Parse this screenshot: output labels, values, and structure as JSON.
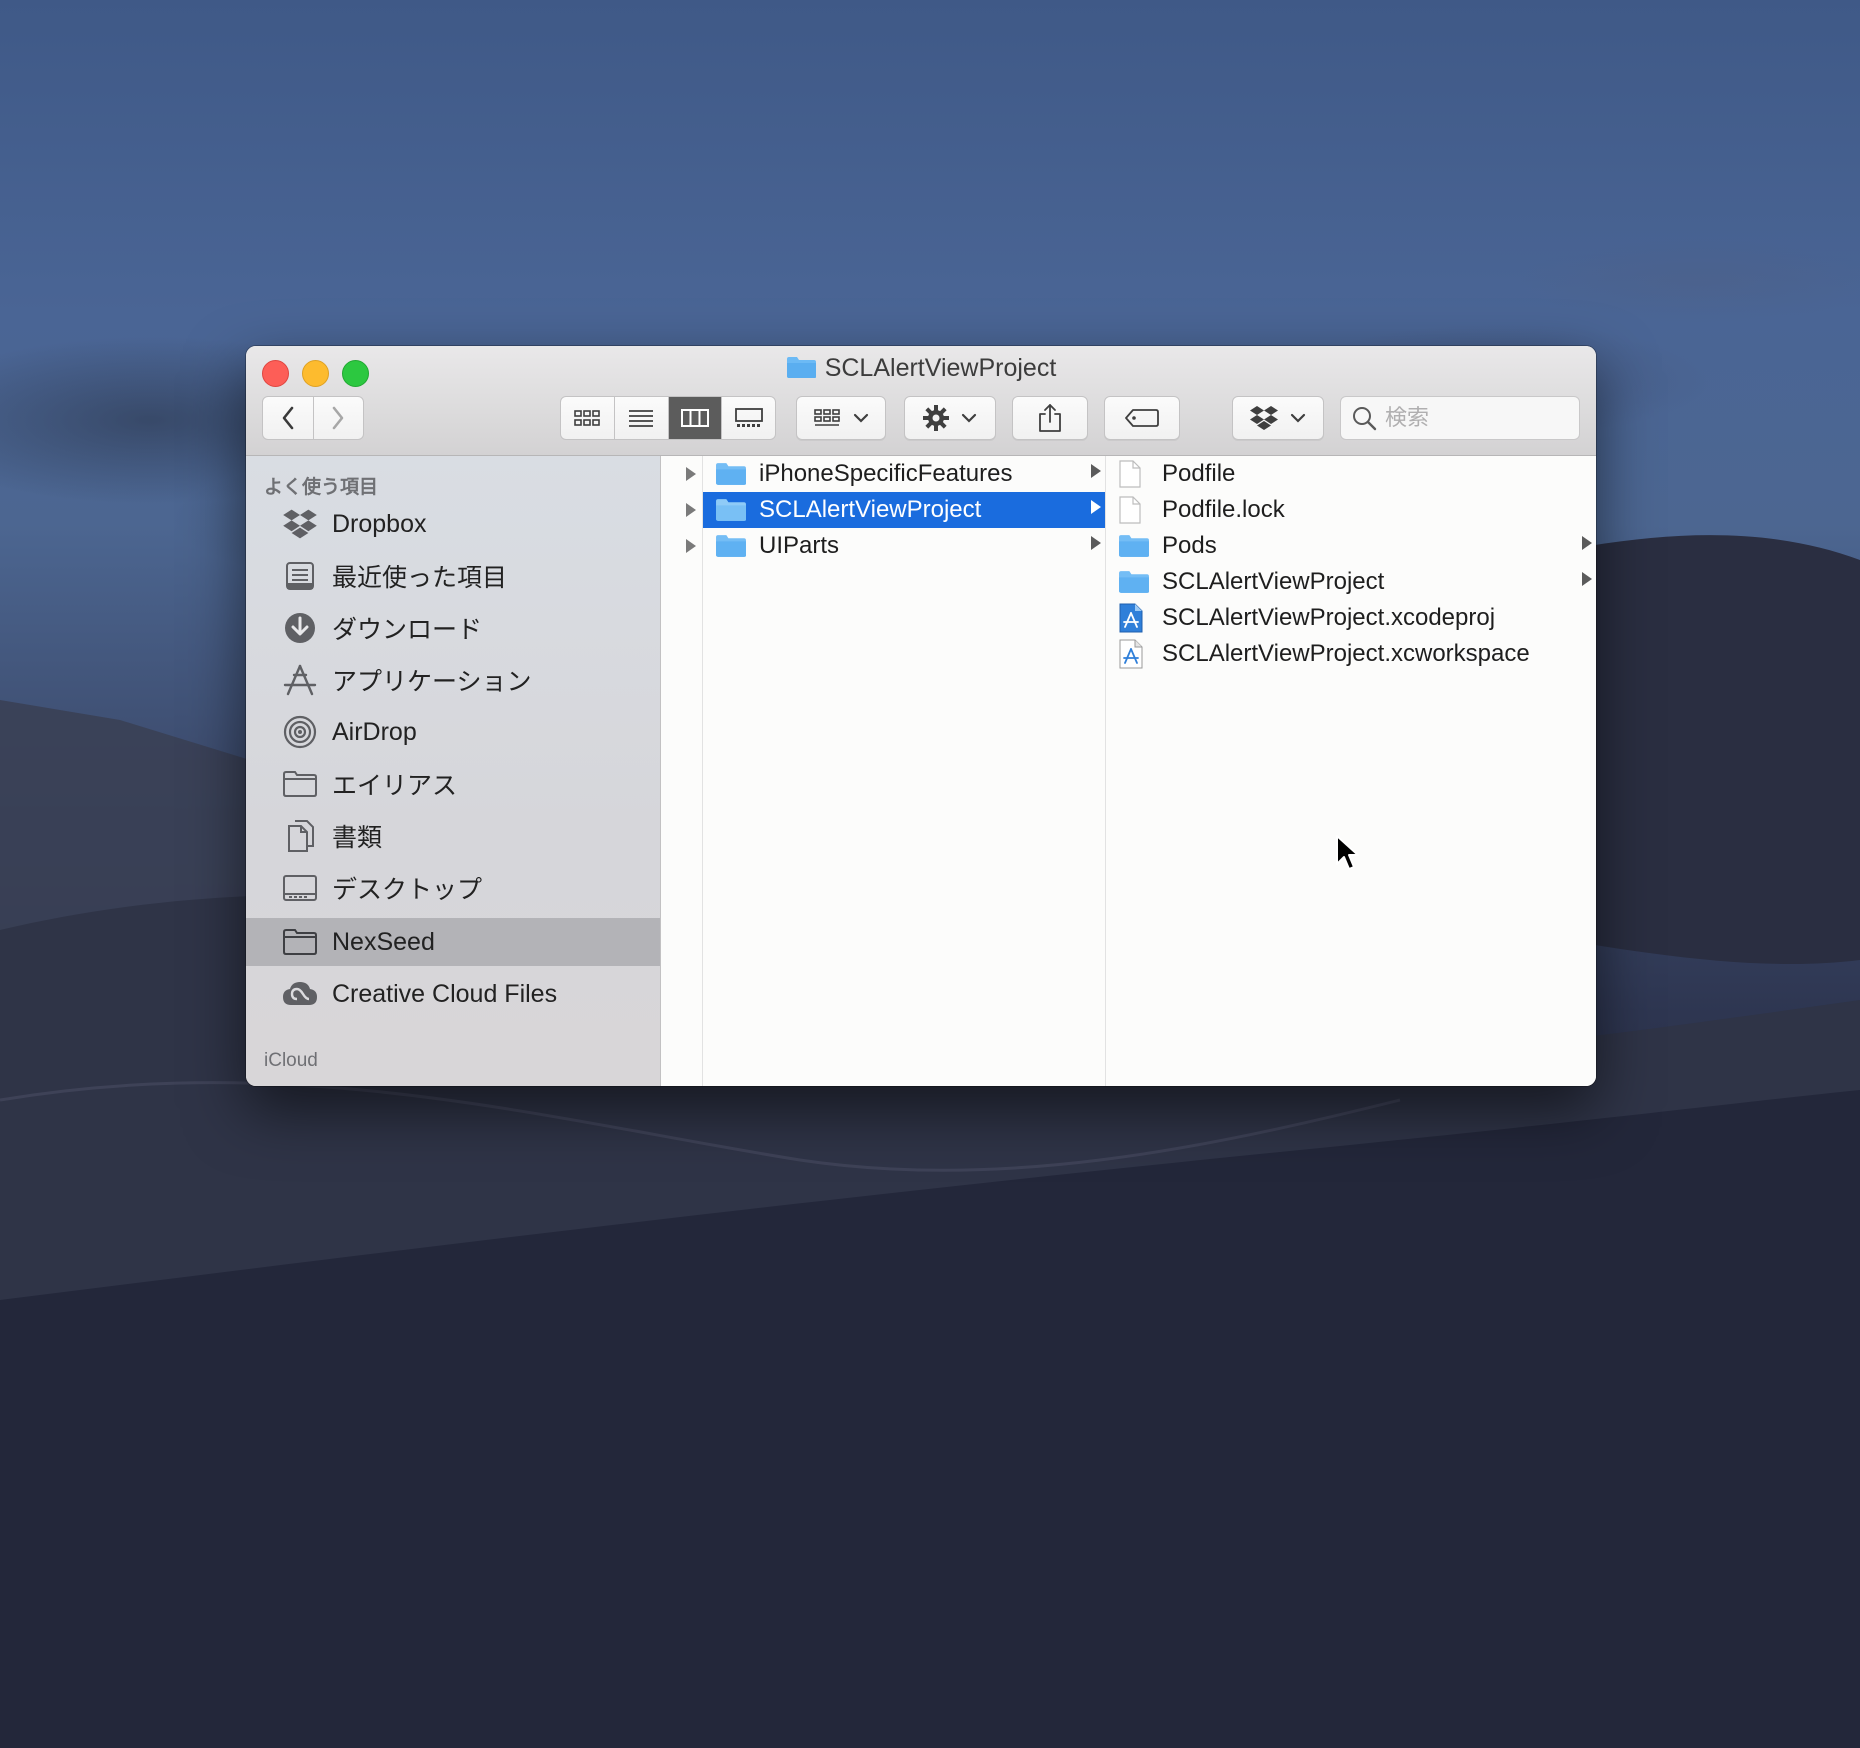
{
  "window": {
    "title": "SCLAlertViewProject"
  },
  "toolbar": {
    "back_icon": "chevron-left-icon",
    "forward_icon": "chevron-right-icon",
    "view_modes": [
      "icon-view-icon",
      "list-view-icon",
      "column-view-icon",
      "gallery-view-icon"
    ],
    "active_view": "column",
    "group_icon": "group-by-icon",
    "action_icon": "gear-icon",
    "share_icon": "share-icon",
    "tag_icon": "tag-icon",
    "dropbox_icon": "dropbox-icon"
  },
  "search": {
    "placeholder": "検索"
  },
  "sidebar": {
    "favorites_header": "よく使う項目",
    "items": [
      {
        "label": "Dropbox",
        "icon": "dropbox-icon"
      },
      {
        "label": "最近使った項目",
        "icon": "recents-icon"
      },
      {
        "label": "ダウンロード",
        "icon": "download-icon"
      },
      {
        "label": "アプリケーション",
        "icon": "applications-icon"
      },
      {
        "label": "AirDrop",
        "icon": "airdrop-icon"
      },
      {
        "label": "エイリアス",
        "icon": "folder-icon"
      },
      {
        "label": "書類",
        "icon": "documents-icon"
      },
      {
        "label": "デスクトップ",
        "icon": "desktop-icon"
      },
      {
        "label": "NexSeed",
        "icon": "folder-icon",
        "selected": true
      },
      {
        "label": "Creative Cloud Files",
        "icon": "creative-cloud-icon"
      }
    ],
    "icloud_header": "iCloud"
  },
  "columns": {
    "middle": [
      {
        "name": "iPhoneSpecificFeatures",
        "type": "folder"
      },
      {
        "name": "SCLAlertViewProject",
        "type": "folder",
        "selected": true
      },
      {
        "name": "UIParts",
        "type": "folder"
      }
    ],
    "right": [
      {
        "name": "Podfile",
        "type": "file"
      },
      {
        "name": "Podfile.lock",
        "type": "file"
      },
      {
        "name": "Pods",
        "type": "folder"
      },
      {
        "name": "SCLAlertViewProject",
        "type": "folder"
      },
      {
        "name": "SCLAlertViewProject.xcodeproj",
        "type": "xcodeproj"
      },
      {
        "name": "SCLAlertViewProject.xcworkspace",
        "type": "xcworkspace"
      }
    ]
  },
  "colors": {
    "selection": "#1a6cde",
    "folder_blue": "#5fb1f2",
    "sidebar_selected": "#b3b3b7"
  }
}
